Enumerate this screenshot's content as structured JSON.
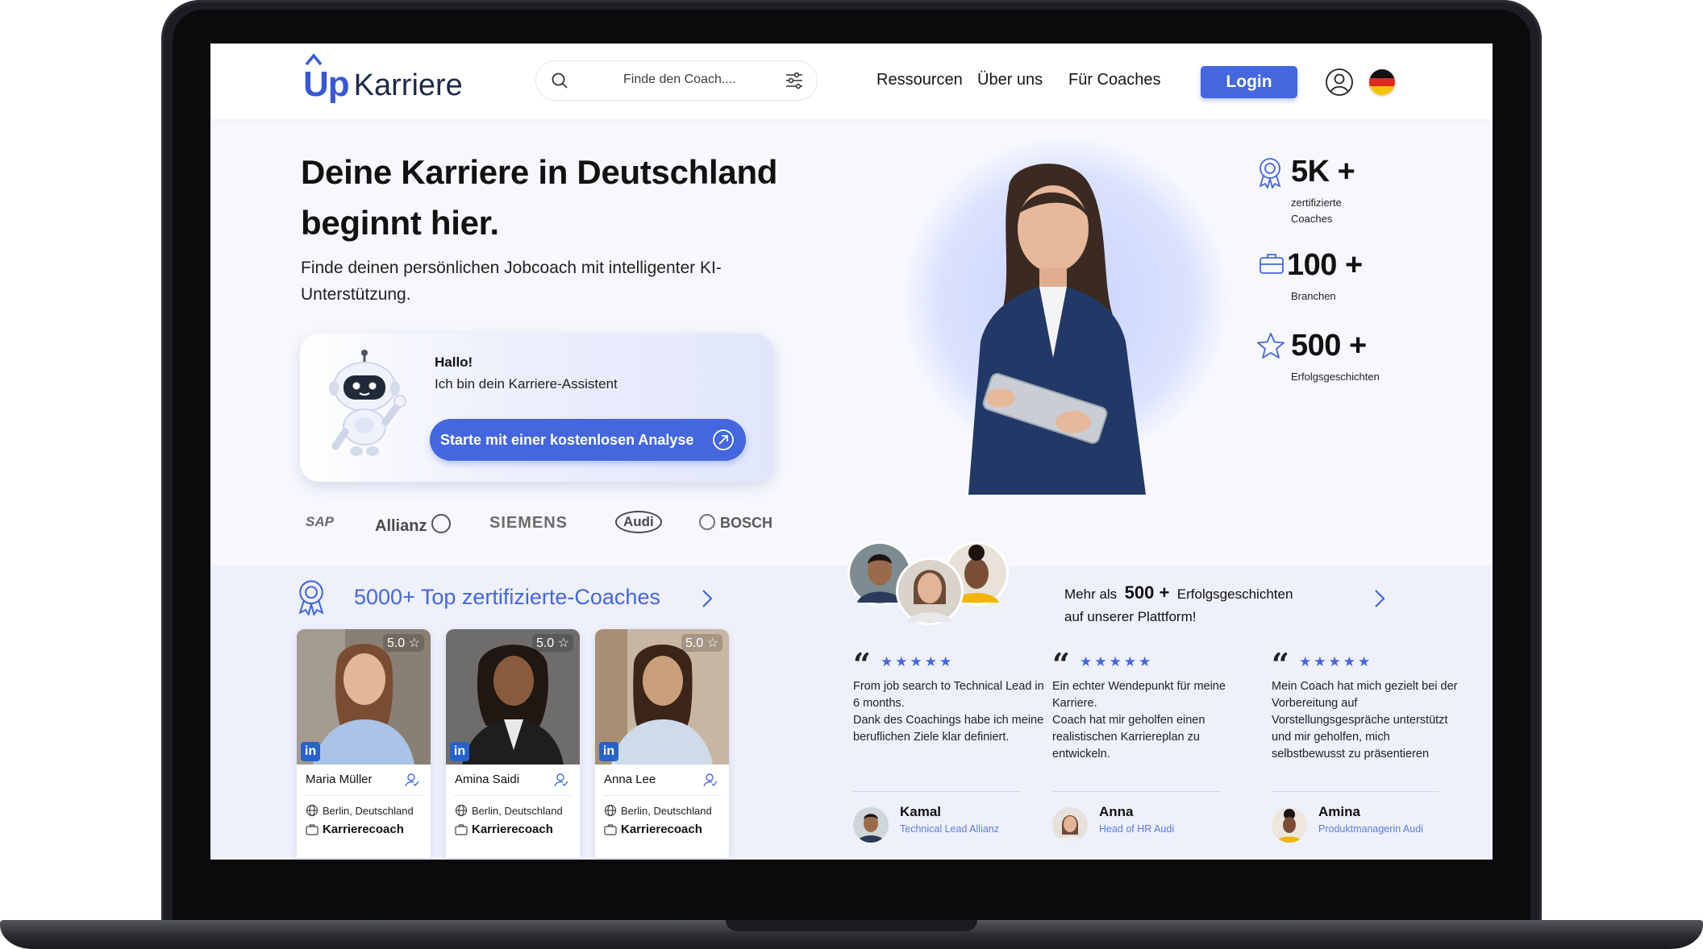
{
  "header": {
    "logo_up": "Up",
    "logo_name": "Karriere",
    "search_placeholder": "Finde den Coach....",
    "nav": [
      "Ressourcen",
      "Über uns",
      "Für Coaches"
    ],
    "login_label": "Login",
    "language": "de-flag-icon"
  },
  "hero": {
    "title": "Deine Karriere in Deutschland beginnt hier.",
    "subtitle": "Finde deinen persönlichen Jobcoach mit intelligenter KI-Unterstützung."
  },
  "assistant": {
    "greeting": "Hallo!",
    "text": "Ich bin dein Karriere-Assistent",
    "button_label": "Starte mit einer kostenlosen Analyse"
  },
  "brands": [
    "SAP",
    "Allianz",
    "SIEMENS",
    "Audi",
    "BOSCH"
  ],
  "stats": [
    {
      "value": "5K +",
      "label_lines": [
        "zertifizierte",
        "Coaches"
      ],
      "icon": "award-icon"
    },
    {
      "value": "100 +",
      "label_lines": [
        "Branchen"
      ],
      "icon": "briefcase-icon"
    },
    {
      "value": "500 +",
      "label_lines": [
        "Erfolgsgeschichten"
      ],
      "icon": "star-icon"
    }
  ],
  "coaches_section": {
    "title": "5000+ Top zertifizierte-Coaches",
    "cards": [
      {
        "name": "Maria Müller",
        "rating": "5.0",
        "location": "Berlin, Deutschland",
        "role": "Karrierecoach"
      },
      {
        "name": "Amina Saidi",
        "rating": "5.0",
        "location": "Berlin, Deutschland",
        "role": "Karrierecoach"
      },
      {
        "name": "Anna Lee",
        "rating": "5.0",
        "location": "Berlin, Deutschland",
        "role": "Karrierecoach"
      }
    ],
    "linkedin_label": "in"
  },
  "testimonials": {
    "intro_prefix": "Mehr als",
    "intro_number": "500 +",
    "intro_suffix": "Erfolgsgeschichten",
    "intro_line2": "auf unserer Plattform!",
    "stars": "★★★★★",
    "quote_mark": "“",
    "items": [
      {
        "text": "From job search to Technical Lead in 6 months.\nDank des Coachings habe ich meine beruflichen Ziele klar definiert.",
        "name": "Kamal",
        "role": "Technical Lead Allianz"
      },
      {
        "text": "Ein echter Wendepunkt für meine Karriere.\nCoach hat mir geholfen einen realistischen Karriereplan zu entwickeln.",
        "name": "Anna",
        "role": "Head of HR Audi"
      },
      {
        "text": "Mein Coach hat mich gezielt bei der Vorbereitung auf Vorstellungsgespräche unterstützt und mir geholfen, mich selbstbewusst zu präsentieren",
        "name": "Amina",
        "role": "Produktmanagerin Audi"
      }
    ]
  },
  "colors": {
    "accent": "#4467e0",
    "brand_dark": "#1f2a4d",
    "hero_bg": "#f7f8fd",
    "section_bg": "#eef0fb"
  }
}
